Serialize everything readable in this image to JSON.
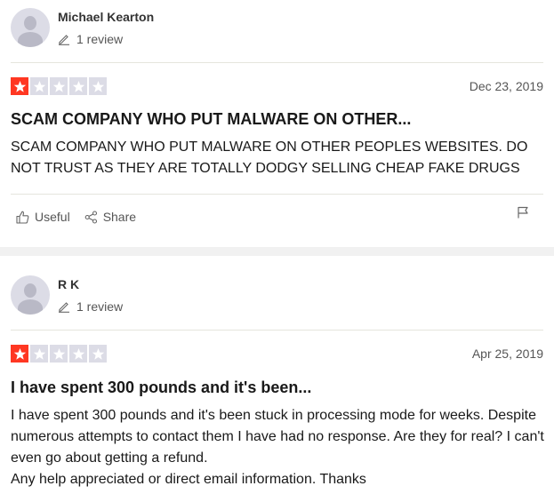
{
  "reviews": [
    {
      "consumer_name": "Michael Kearton",
      "review_count": "1 review",
      "rating": 1,
      "date": "Dec 23, 2019",
      "title": "SCAM COMPANY WHO PUT MALWARE ON OTHER...",
      "text": "SCAM COMPANY WHO PUT MALWARE ON OTHER PEOPLES WEBSITES. DO NOT TRUST AS THEY ARE TOTALLY DODGY SELLING CHEAP FAKE DRUGS",
      "useful_label": "Useful",
      "share_label": "Share"
    },
    {
      "consumer_name": "R K",
      "review_count": "1 review",
      "rating": 1,
      "date": "Apr 25, 2019",
      "title": "I have spent 300 pounds and it's been...",
      "text": "I have spent 300 pounds and it's been stuck in processing mode for weeks. Despite numerous attempts to contact them I have had no response. Are they for real? I can't even go about getting a refund.\nAny help appreciated or direct email information. Thanks"
    }
  ],
  "colors": {
    "star_active": "#ff3722",
    "star_inactive": "#dcdce6",
    "separator": "#f1f1f1"
  },
  "icons": [
    "pencil-icon",
    "star-icon",
    "thumbs-up-icon",
    "share-icon",
    "flag-icon"
  ]
}
